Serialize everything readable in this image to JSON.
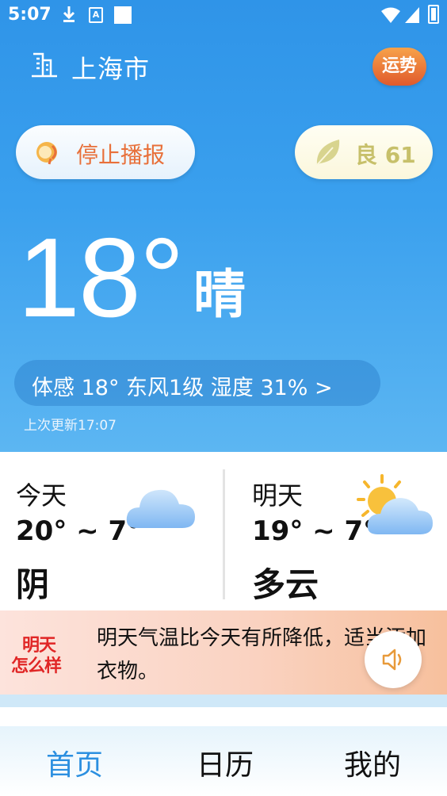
{
  "status_bar": {
    "time": "5:07",
    "a_label": "A"
  },
  "header": {
    "city": "上海市",
    "fortune_label": "运势"
  },
  "broadcast": {
    "label": "停止播报"
  },
  "air_quality": {
    "label": "良 61",
    "color": "#c7c06a"
  },
  "current": {
    "temperature": "18°",
    "condition": "晴",
    "details": "体感 18°  东风1级  湿度 31%  >",
    "updated": "上次更新17:07"
  },
  "forecast": {
    "today": {
      "day": "今天",
      "range": "20° ~ 7°",
      "condition": "阴",
      "icon": "cloud-icon"
    },
    "tomorrow": {
      "day": "明天",
      "range": "19° ~ 7°",
      "condition": "多云",
      "icon": "partly-cloudy-icon"
    }
  },
  "tip": {
    "logo_line1": "明天",
    "logo_line2": "怎么样",
    "text": "明天气温比今天有所降低，适当添加衣物。"
  },
  "nav": {
    "items": [
      {
        "label": "首页",
        "active": true
      },
      {
        "label": "日历",
        "active": false
      },
      {
        "label": "我的",
        "active": false
      }
    ]
  },
  "colors": {
    "accent": "#2b8fe0",
    "hero_top": "#2f94e8",
    "broadcast_text": "#e8703a"
  }
}
